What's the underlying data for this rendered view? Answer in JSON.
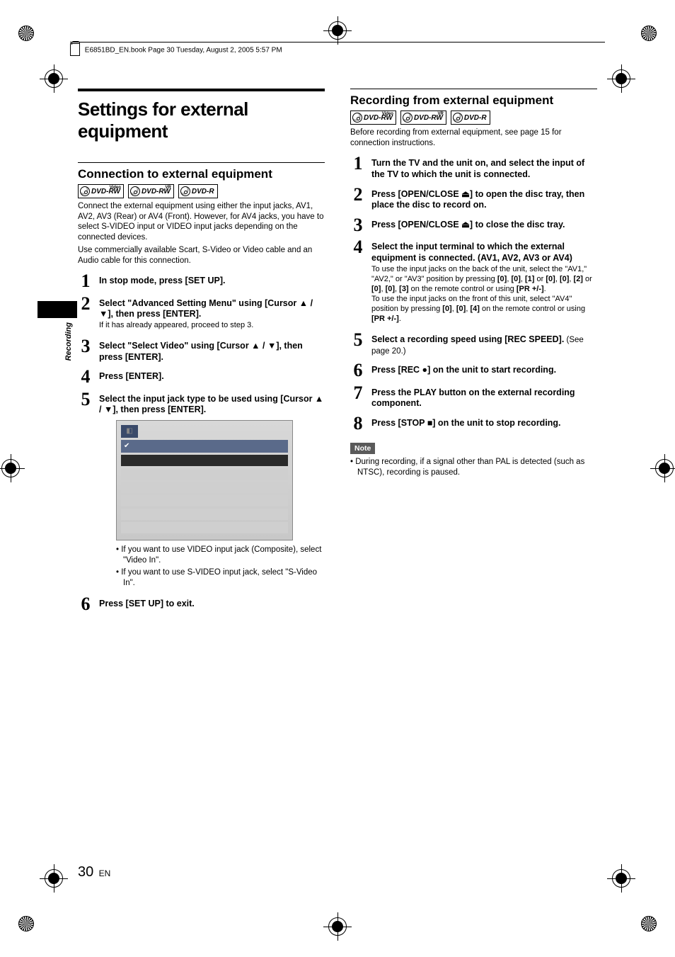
{
  "header": "E6851BD_EN.book  Page 30  Tuesday, August 2, 2005  5:57 PM",
  "side_label": "Recording",
  "page_number": "30",
  "page_lang": "EN",
  "left": {
    "title": "Settings for external equipment",
    "section": "Connection to external equipment",
    "badges": [
      {
        "sup": "Video",
        "text": "DVD-RW"
      },
      {
        "sup": "VR",
        "text": "DVD-RW"
      },
      {
        "sup": "",
        "text": "DVD-R"
      }
    ],
    "para1": "Connect the external equipment using either the input jacks, AV1, AV2, AV3 (Rear) or AV4 (Front). However, for AV4 jacks, you have to select S-VIDEO input or VIDEO input jacks depending on the connected devices.",
    "para2": "Use commercially available Scart, S-Video or Video cable and an Audio cable for this connection.",
    "steps": [
      {
        "n": "1",
        "title": "In stop mode, press [SET UP]."
      },
      {
        "n": "2",
        "title": "Select \"Advanced Setting Menu\" using [Cursor ▲ / ▼], then press [ENTER].",
        "detail": "If it has already appeared, proceed to step 3."
      },
      {
        "n": "3",
        "title": "Select \"Select Video\" using [Cursor ▲ / ▼], then press [ENTER]."
      },
      {
        "n": "4",
        "title": "Press [ENTER]."
      },
      {
        "n": "5",
        "title": "Select the input jack type to be used using [Cursor ▲ / ▼], then press [ENTER]."
      },
      {
        "n": "6",
        "title": "Press [SET UP] to exit."
      }
    ],
    "bullets": [
      "If you want to use VIDEO input jack (Composite), select \"Video In\".",
      "If you want to use S-VIDEO input jack, select \"S-Video In\"."
    ]
  },
  "right": {
    "section": "Recording from external equipment",
    "badges": [
      {
        "sup": "Video",
        "text": "DVD-RW"
      },
      {
        "sup": "VR",
        "text": "DVD-RW"
      },
      {
        "sup": "",
        "text": "DVD-R"
      }
    ],
    "para": "Before recording from external equipment, see page 15 for connection instructions.",
    "steps": [
      {
        "n": "1",
        "title": "Turn the TV and the unit on, and select the input of the TV to which the unit is connected."
      },
      {
        "n": "2",
        "title": "Press [OPEN/CLOSE ⏏] to open the disc tray, then place the disc to record on."
      },
      {
        "n": "3",
        "title": "Press [OPEN/CLOSE ⏏] to close the disc tray."
      },
      {
        "n": "4",
        "title": "Select the input terminal to which the external equipment is connected. (AV1, AV2, AV3 or AV4)",
        "detail_parts": [
          {
            "t": "To use the input jacks on the back of the unit, select the \"AV1,\" \"AV2,\" or \"AV3\" position by pressing "
          },
          {
            "b": "[0]"
          },
          {
            "t": ", "
          },
          {
            "b": "[0]"
          },
          {
            "t": ", "
          },
          {
            "b": "[1]"
          },
          {
            "t": " or "
          },
          {
            "b": "[0]"
          },
          {
            "t": ", "
          },
          {
            "b": "[0]"
          },
          {
            "t": ", "
          },
          {
            "b": "[2]"
          },
          {
            "t": " or "
          },
          {
            "b": "[0]"
          },
          {
            "t": ", "
          },
          {
            "b": "[0]"
          },
          {
            "t": ", "
          },
          {
            "b": "[3]"
          },
          {
            "t": " on the remote control or using "
          },
          {
            "b": "[PR +/-]"
          },
          {
            "t": "."
          },
          {
            "br": true
          },
          {
            "t": "To use the input jacks on the front of this unit, select \"AV4\" position by pressing "
          },
          {
            "b": "[0]"
          },
          {
            "t": ", "
          },
          {
            "b": "[0]"
          },
          {
            "t": ", "
          },
          {
            "b": "[4]"
          },
          {
            "t": " on the remote control or using "
          },
          {
            "b": "[PR +/-]"
          },
          {
            "t": "."
          }
        ]
      },
      {
        "n": "5",
        "title": "Select a recording speed using [REC SPEED].",
        "tail_light": " (See page 20.)"
      },
      {
        "n": "6",
        "title": "Press [REC ●] on the unit to start recording."
      },
      {
        "n": "7",
        "title": "Press the PLAY button on the external recording component."
      },
      {
        "n": "8",
        "title": "Press [STOP ■] on the unit to stop recording."
      }
    ],
    "note_label": "Note",
    "note": "During recording, if a signal other than PAL is detected (such as NTSC), recording is paused."
  }
}
